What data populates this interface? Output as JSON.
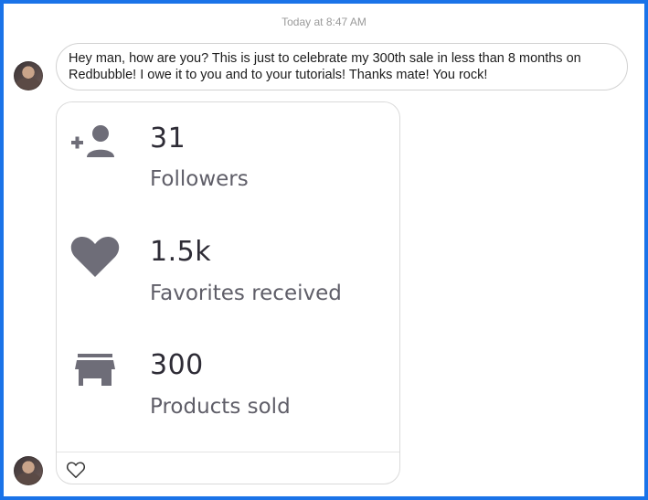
{
  "conversation": {
    "timestamp": "Today at 8:47 AM",
    "message_text": "Hey man, how are you? This is just to celebrate my 300th sale in less than 8 months on Redbubble! I owe it to you and to your tutorials! Thanks mate! You rock!"
  },
  "stats_card": {
    "stats": [
      {
        "icon": "add-person-icon",
        "value": "31",
        "label": "Followers"
      },
      {
        "icon": "heart-icon",
        "value": "1.5k",
        "label": "Favorites received"
      },
      {
        "icon": "shop-icon",
        "value": "300",
        "label": "Products sold"
      }
    ]
  },
  "reaction": {
    "icon": "heart-outline-icon"
  },
  "colors": {
    "frame_border": "#1a73e8",
    "icon_gray": "#6e6d78",
    "value_text": "#2e2c36",
    "label_text": "#5f5e68"
  }
}
